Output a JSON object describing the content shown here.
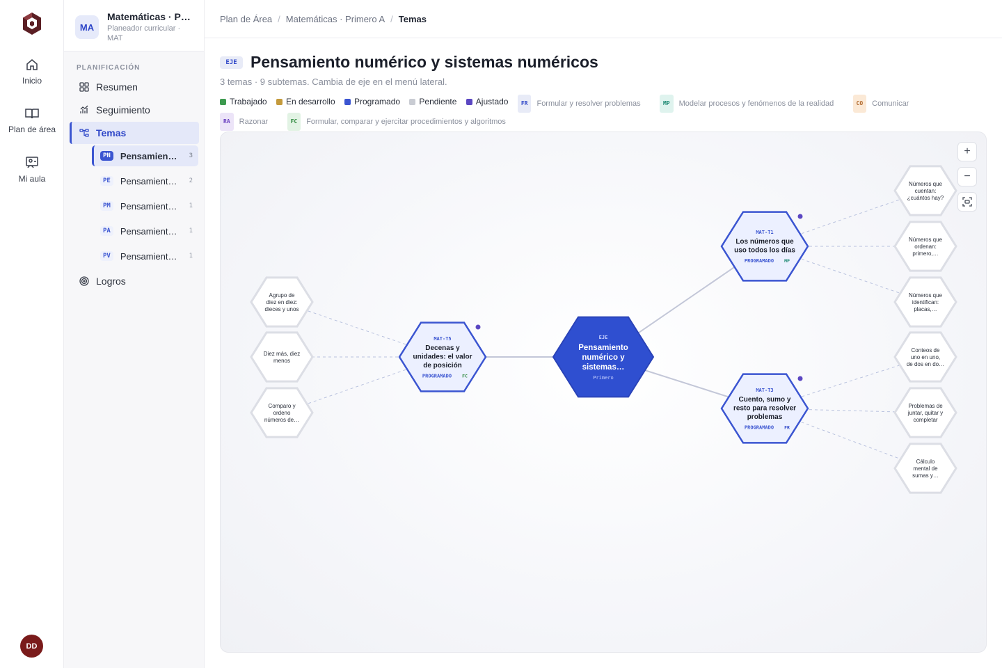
{
  "rail": {
    "items": [
      {
        "label": "Inicio",
        "icon": "home-icon"
      },
      {
        "label": "Plan de área",
        "icon": "book-icon"
      },
      {
        "label": "Mi aula",
        "icon": "classroom-icon"
      }
    ],
    "avatar": "DD"
  },
  "sidebar": {
    "badge": "MA",
    "title": "Matemáticas · Pr…",
    "subtitle": "Planeador curricular · MAT",
    "section_label": "PLANIFICACIÓN",
    "nav": [
      {
        "label": "Resumen",
        "icon": "grid-icon"
      },
      {
        "label": "Seguimiento",
        "icon": "chart-icon"
      },
      {
        "label": "Temas",
        "icon": "tree-icon"
      },
      {
        "label": "Logros",
        "icon": "target-icon"
      }
    ],
    "subitems": [
      {
        "code": "PN",
        "label": "Pensamient…",
        "count": "3"
      },
      {
        "code": "PE",
        "label": "Pensamient…",
        "count": "2"
      },
      {
        "code": "PM",
        "label": "Pensamient…",
        "count": "1"
      },
      {
        "code": "PA",
        "label": "Pensamient…",
        "count": "1"
      },
      {
        "code": "PV",
        "label": "Pensamient…",
        "count": "1"
      }
    ]
  },
  "breadcrumb": [
    "Plan de Área",
    "Matemáticas · Primero A",
    "Temas"
  ],
  "header": {
    "tag": "EJE",
    "title": "Pensamiento numérico y sistemas numéricos",
    "subtitle": "3 temas · 9 subtemas. Cambia de eje en el menú lateral."
  },
  "legend": {
    "status": [
      {
        "label": "Trabajado",
        "color": "#3d9a4f"
      },
      {
        "label": "En desarrollo",
        "color": "#c49a3c"
      },
      {
        "label": "Programado",
        "color": "#3b55d1"
      },
      {
        "label": "Pendiente",
        "color": "#c9ccd3"
      },
      {
        "label": "Ajustado",
        "color": "#5b47c2"
      }
    ],
    "competencies": [
      {
        "code": "FR",
        "label": "Formular y resolver problemas",
        "fg": "#2f47c8",
        "bg": "#e8ebf7"
      },
      {
        "code": "MP",
        "label": "Modelar procesos y fenómenos de la realidad",
        "fg": "#1f8a74",
        "bg": "#dff3ee"
      },
      {
        "code": "CO",
        "label": "Comunicar",
        "fg": "#b0672a",
        "bg": "#fbe9d6"
      },
      {
        "code": "RA",
        "label": "Razonar",
        "fg": "#6a3fc0",
        "bg": "#ece4f8"
      },
      {
        "code": "FC",
        "label": "Formular, comparar y ejercitar procedimientos y algoritmos",
        "fg": "#2f8a3f",
        "bg": "#e2f3e4"
      }
    ]
  },
  "graph": {
    "center": {
      "tag": "EJE",
      "lines": [
        "Pensamiento",
        "numérico y",
        "sistemas…"
      ],
      "sub": "Primero"
    },
    "topics": [
      {
        "id": "t1",
        "code": "MAT-T1",
        "lines": [
          "Los números que",
          "uso todos los días"
        ],
        "status": "PROGRAMADO",
        "comp": "MP"
      },
      {
        "id": "t3",
        "code": "MAT-T3",
        "lines": [
          "Cuento, sumo y",
          "resto para resolver",
          "problemas"
        ],
        "status": "PROGRAMADO",
        "comp": "FR"
      },
      {
        "id": "t5",
        "code": "MAT-T5",
        "lines": [
          "Decenas y",
          "unidades: el valor",
          "de posición"
        ],
        "status": "PROGRAMADO",
        "comp": "FC"
      }
    ],
    "subtopics": [
      {
        "parent": "t1",
        "lines": [
          "Números que",
          "cuentan:",
          "¿cuántos hay?"
        ]
      },
      {
        "parent": "t1",
        "lines": [
          "Números que",
          "ordenan:",
          "primero,…"
        ]
      },
      {
        "parent": "t1",
        "lines": [
          "Números que",
          "identifican:",
          "placas,…"
        ]
      },
      {
        "parent": "t3",
        "lines": [
          "Conteos de",
          "uno en uno,",
          "de dos en do…"
        ]
      },
      {
        "parent": "t3",
        "lines": [
          "Problemas de",
          "juntar, quitar y",
          "completar"
        ]
      },
      {
        "parent": "t3",
        "lines": [
          "Cálculo",
          "mental de",
          "sumas y…"
        ]
      },
      {
        "parent": "t5",
        "lines": [
          "Agrupo de",
          "diez en diez:",
          "dieces y unos"
        ]
      },
      {
        "parent": "t5",
        "lines": [
          "Diez más, diez",
          "menos"
        ]
      },
      {
        "parent": "t5",
        "lines": [
          "Comparo y",
          "ordeno",
          "números de…"
        ]
      }
    ],
    "controls": [
      "+",
      "−"
    ]
  },
  "colors": {
    "accent": "#3b55d1",
    "accent_dark": "#2a43b8",
    "ajustado": "#5b47c2"
  }
}
